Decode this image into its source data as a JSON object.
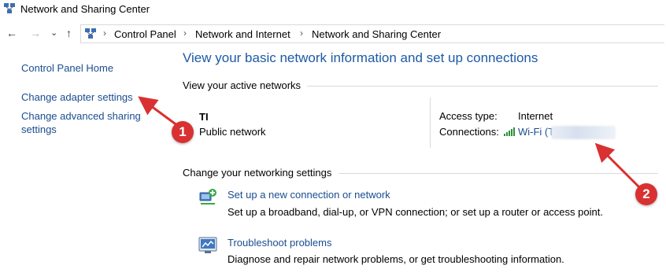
{
  "window": {
    "title": "Network and Sharing Center"
  },
  "nav": {
    "back": "←",
    "forward": "→",
    "recent": "⌄",
    "up": "↑"
  },
  "breadcrumb": {
    "items": [
      "Control Panel",
      "Network and Internet",
      "Network and Sharing Center"
    ],
    "separator": "›"
  },
  "sidebar": {
    "items": [
      {
        "label": "Control Panel Home"
      },
      {
        "label": "Change adapter settings"
      },
      {
        "label": "Change advanced sharing settings"
      }
    ]
  },
  "main": {
    "title": "View your basic network information and set up connections",
    "active_networks_label": "View your active networks",
    "network": {
      "name": "T‍I",
      "type": "Public network",
      "access_type_label": "Access type:",
      "access_type_value": "Internet",
      "connections_label": "Connections:",
      "connections_value": "Wi-Fi (T"
    },
    "change_settings_label": "Change your networking settings",
    "tasks": [
      {
        "link": "Set up a new connection or network",
        "description": "Set up a broadband, dial-up, or VPN connection; or set up a router or access point."
      },
      {
        "link": "Troubleshoot problems",
        "description": "Diagnose and repair network problems, or get troubleshooting information."
      }
    ]
  },
  "annotations": {
    "callout_1": "1",
    "callout_2": "2",
    "accent_color": "#d93131"
  },
  "icons": {
    "title": "network-center-icon",
    "address": "network-center-icon",
    "signal": "wifi-signal-icon",
    "task1": "new-connection-icon",
    "task2": "troubleshoot-icon"
  }
}
